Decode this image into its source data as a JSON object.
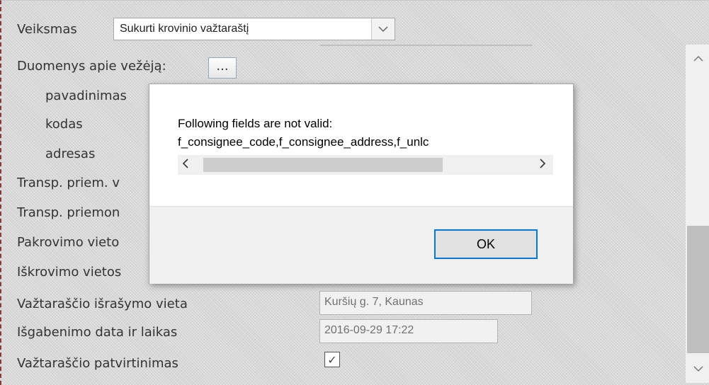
{
  "form": {
    "veiksmas_label": "Veiksmas",
    "veiksmas_value": "Sukurti krovinio važtaraštį",
    "carrier_label": "Duomenys apie vežėją:",
    "carrier_button": "...",
    "pavadinimas_label": "pavadinimas",
    "kodas_label": "kodas",
    "adresas_label": "adresas",
    "transp_priem_v_label": "Transp. priem. v",
    "transp_priemon_label": "Transp. priemon",
    "pakrovimo_label": "Pakrovimo vieto",
    "iskrovimo_label": "Iškrovimo vietos",
    "israsymo_label": "Važtaraščio išrašymo vieta",
    "israsymo_value": "Kuršių g. 7, Kaunas",
    "isgabenimo_label": "Išgabenimo data ir laikas",
    "isgabenimo_value": "2016-09-29 17:22",
    "patvirtinimas_label": "Važtaraščio patvirtinimas",
    "patvirtinimas_checked": "✓"
  },
  "dialog": {
    "message_line1": "Following fields are not valid:",
    "message_line2": "f_consignee_code,f_consignee_address,f_unlc",
    "ok_label": "OK"
  },
  "icons": {
    "dropdown": "chevron-down-icon",
    "scroll_up": "chevron-up-icon",
    "scroll_down": "chevron-down-icon",
    "scroll_left": "chevron-left-icon",
    "scroll_right": "chevron-right-icon"
  },
  "colors": {
    "accent": "#0078d7"
  }
}
